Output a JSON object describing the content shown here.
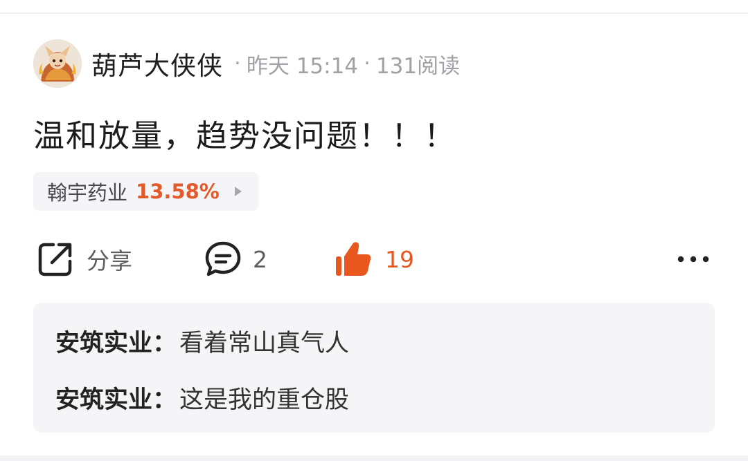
{
  "post": {
    "author": "葫芦大侠侠",
    "separator": "·",
    "time": "昨天 15:14",
    "reads": "131阅读",
    "text": "温和放量，趋势没问题！！！"
  },
  "stock_tag": {
    "name": "翰宇药业",
    "change": "13.58%",
    "change_color": "#e35a2a"
  },
  "actions": {
    "share_label": "分享",
    "comment_count": "2",
    "like_count": "19",
    "like_color": "#e8571e"
  },
  "comments": [
    {
      "user": "安筑实业",
      "colon": "：",
      "text": "看着常山真气人"
    },
    {
      "user": "安筑实业",
      "colon": "：",
      "text": "这是我的重仓股"
    }
  ],
  "icons": {
    "avatar": "avatar-image",
    "share": "share-icon",
    "comment": "comment-icon",
    "like": "thumbs-up-icon",
    "more": "more-dots-icon",
    "stock_arrow": "play-arrow-icon"
  }
}
